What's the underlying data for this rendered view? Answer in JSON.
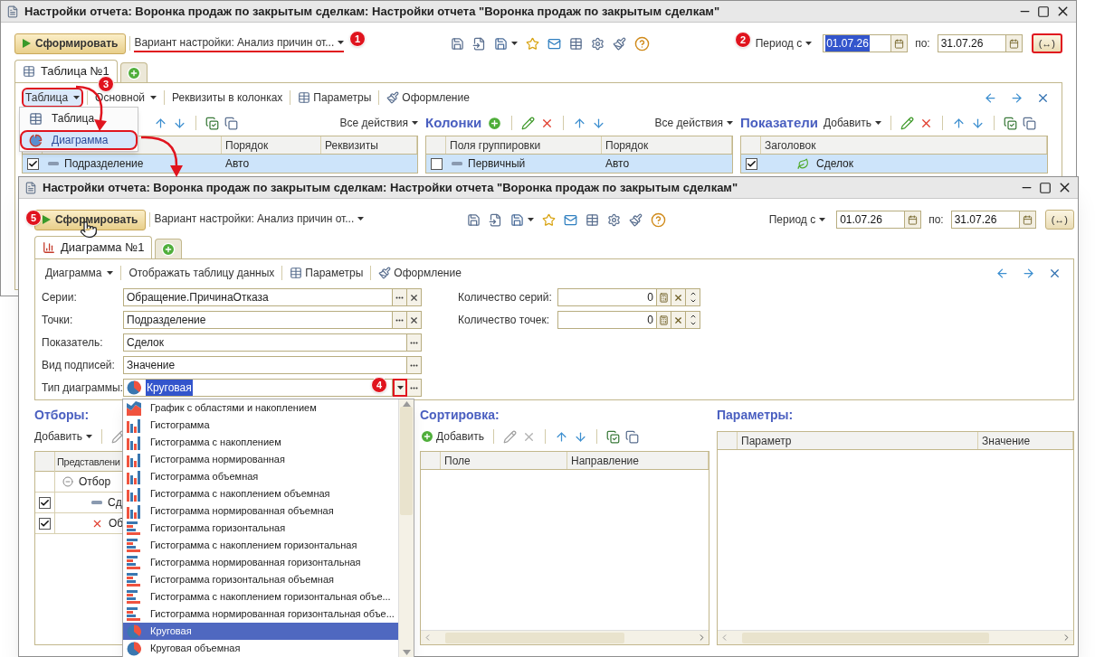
{
  "back_window": {
    "title": "Настройки отчета: Воронка продаж по закрытым сделкам: Настройки отчета \"Воронка продаж по закрытым сделкам\"",
    "toolbar": {
      "run_button": {
        "label": "Сформировать",
        "hovered": false
      },
      "variant": {
        "label": "Вариант настройки: Анализ причин от...",
        "highlighted": true
      },
      "period_label": "Период с",
      "date_from": {
        "value": "01.07.26",
        "selected": true
      },
      "to_label": "по:",
      "date_to": {
        "value": "31.07.26",
        "selected": false
      },
      "period_button": {
        "label": "(↔)",
        "highlighted": true
      }
    },
    "tabs": [
      {
        "kind": "table",
        "label": "Таблица №1",
        "selected": true
      },
      {
        "kind": "add",
        "selected": false
      }
    ],
    "panel_toolbar": [
      {
        "kind": "menu",
        "label": "Таблица",
        "highlighted": true
      },
      {
        "kind": "menu",
        "label": "Основной",
        "highlighted": false
      },
      {
        "kind": "plain",
        "label": "Реквизиты в колонках",
        "highlighted": false
      },
      {
        "kind": "params",
        "label": "Параметры",
        "highlighted": false
      },
      {
        "kind": "design",
        "label": "Оформление",
        "highlighted": false
      }
    ],
    "menu": [
      {
        "kind": "table",
        "label": "Таблица",
        "selected": false,
        "highlighted": false
      },
      {
        "kind": "chart",
        "label": "Диаграмма",
        "selected": true,
        "highlighted": true
      }
    ],
    "groups_panel": {
      "all_actions": "Все действия",
      "columns": [
        "Порядок",
        "Реквизиты"
      ],
      "rows": [
        {
          "checked": true,
          "field": "Подразделение",
          "order": "Авто",
          "selected": true
        }
      ]
    },
    "columns_panel": {
      "title": "Колонки",
      "all_actions": "Все действия",
      "columns": [
        "Поля группировки",
        "Порядок"
      ],
      "rows": [
        {
          "checked": false,
          "field": "Первичный",
          "order": "Авто",
          "selected": true
        }
      ]
    },
    "indicators_panel": {
      "title": "Показатели",
      "add_button": "Добавить",
      "columns": [
        "Заголовок"
      ],
      "rows": [
        {
          "checked": true,
          "field": "Сделок",
          "selected": true
        }
      ]
    }
  },
  "front_window": {
    "title": "Настройки отчета: Воронка продаж по закрытым сделкам: Настройки отчета \"Воронка продаж по закрытым сделкам\"",
    "toolbar": {
      "run_button": {
        "label": "Сформировать",
        "hovered": true
      },
      "variant": {
        "label": "Вариант настройки: Анализ причин от...",
        "highlighted": false
      },
      "period_label": "Период с",
      "date_from": {
        "value": "01.07.26",
        "selected": false
      },
      "to_label": "по:",
      "date_to": {
        "value": "31.07.26",
        "selected": false
      },
      "period_button": {
        "label": "(↔)",
        "highlighted": false
      }
    },
    "tabs": [
      {
        "kind": "chart",
        "label": "Диаграмма №1",
        "selected": true
      },
      {
        "kind": "add",
        "selected": false
      }
    ],
    "panel_toolbar": [
      {
        "kind": "menu",
        "label": "Диаграмма",
        "highlighted": false
      },
      {
        "kind": "plain",
        "label": "Отображать таблицу данных",
        "highlighted": false
      },
      {
        "kind": "params",
        "label": "Параметры",
        "highlighted": false
      },
      {
        "kind": "design",
        "label": "Оформление",
        "highlighted": false
      }
    ],
    "fields": [
      {
        "label": "Серии:",
        "value": "Обращение.ПричинаОтказа",
        "clearable": true
      },
      {
        "label": "Точки:",
        "value": "Подразделение",
        "clearable": true
      },
      {
        "label": "Показатель:",
        "value": "Сделок",
        "clearable": false
      },
      {
        "label": "Вид подписей:",
        "value": "Значение",
        "clearable": false
      }
    ],
    "chart_type": {
      "label": "Тип диаграммы:",
      "value": "Круговая",
      "highlighted": true
    },
    "counts": [
      {
        "label": "Количество серий:",
        "value": "0"
      },
      {
        "label": "Количество точек:",
        "value": "0"
      }
    ],
    "filters": {
      "title": "Отборы:",
      "add_button": "Добавить",
      "columns": [
        "Представлени"
      ],
      "rows": [
        {
          "kind": "group",
          "label": "Отбор"
        },
        {
          "kind": "item",
          "checked": true,
          "label": "Сд"
        },
        {
          "kind": "excluded",
          "checked": true,
          "label": "Об"
        }
      ]
    },
    "sorting": {
      "title": "Сортировка:",
      "add_button": "Добавить",
      "columns": [
        "Поле",
        "Направление"
      ]
    },
    "parameters": {
      "title": "Параметры:",
      "columns": [
        "Параметр",
        "Значение"
      ]
    },
    "chart_types": [
      {
        "kind": "area",
        "label": "График с областями и накоплением",
        "selected": false
      },
      {
        "kind": "column",
        "label": "Гистограмма",
        "selected": false
      },
      {
        "kind": "column",
        "label": "Гистограмма с накоплением",
        "selected": false
      },
      {
        "kind": "column",
        "label": "Гистограмма нормированная",
        "selected": false
      },
      {
        "kind": "column",
        "label": "Гистограмма объемная",
        "selected": false
      },
      {
        "kind": "column",
        "label": "Гистограмма с накоплением объемная",
        "selected": false
      },
      {
        "kind": "column",
        "label": "Гистограмма нормированная объемная",
        "selected": false
      },
      {
        "kind": "hbar",
        "label": "Гистограмма горизонтальная",
        "selected": false
      },
      {
        "kind": "hbar",
        "label": "Гистограмма с накоплением горизонтальная",
        "selected": false
      },
      {
        "kind": "hbar",
        "label": "Гистограмма нормированная горизонтальная",
        "selected": false
      },
      {
        "kind": "hbar",
        "label": "Гистограмма горизонтальная объемная",
        "selected": false
      },
      {
        "kind": "hbar",
        "label": "Гистограмма с накоплением горизонтальная объе...",
        "selected": false
      },
      {
        "kind": "hbar",
        "label": "Гистограмма нормированная горизонтальная объе...",
        "selected": false
      },
      {
        "kind": "pie",
        "label": "Круговая",
        "selected": true
      },
      {
        "kind": "pie",
        "label": "Круговая объемная",
        "selected": false
      }
    ]
  },
  "annotations": [
    "1",
    "2",
    "3",
    "4",
    "5"
  ]
}
